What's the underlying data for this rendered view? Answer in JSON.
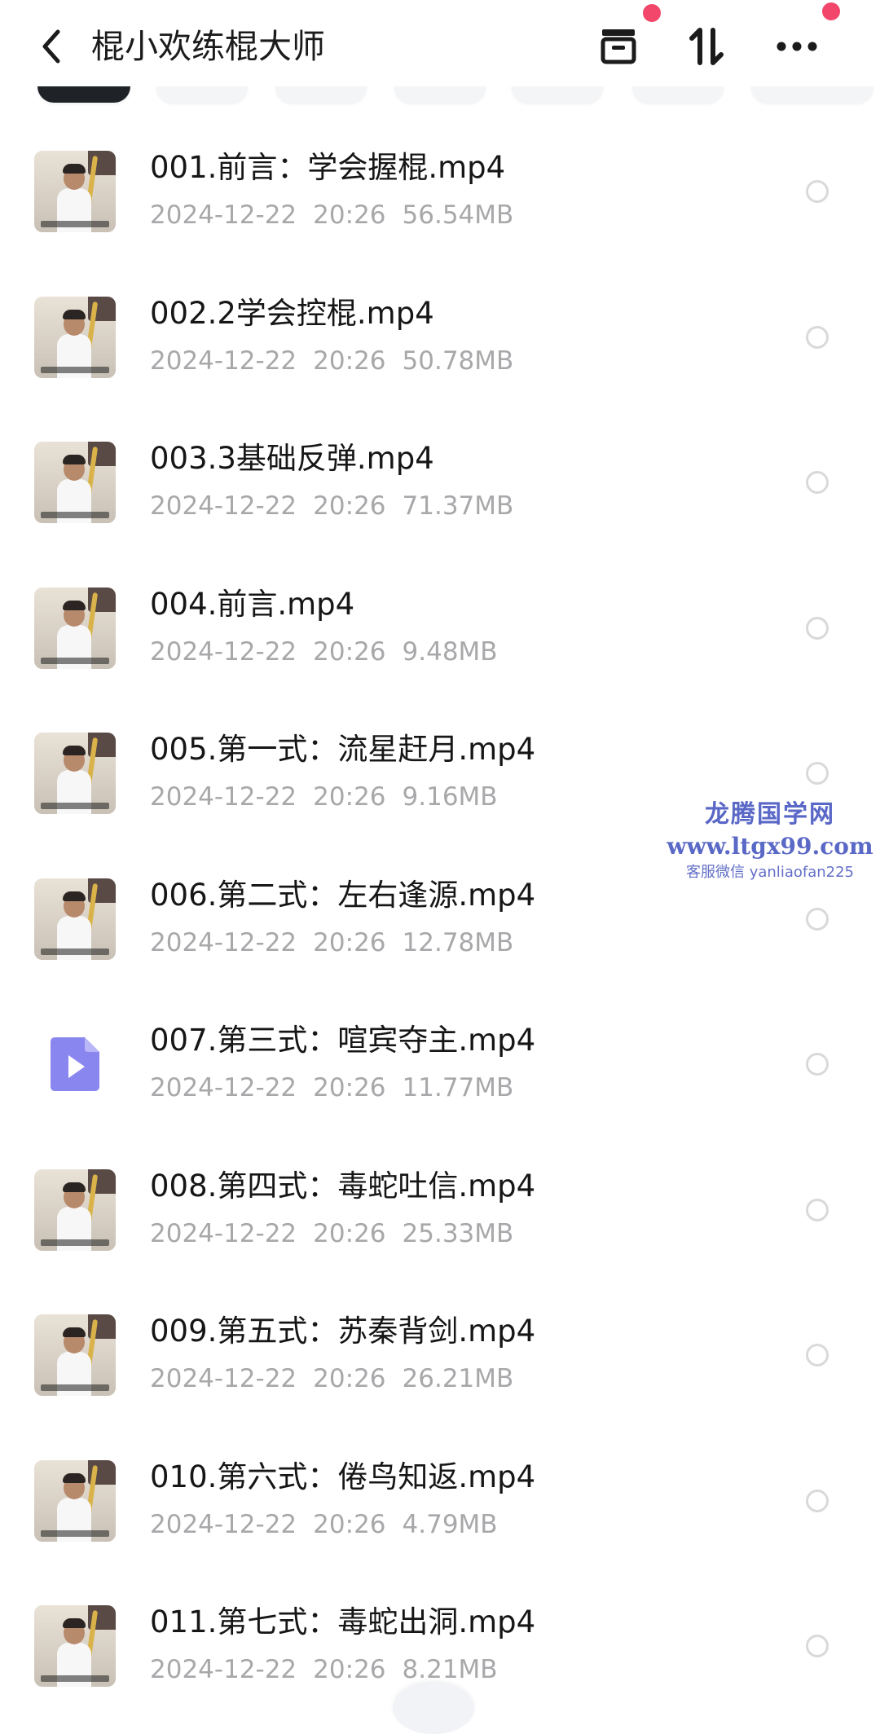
{
  "header": {
    "title": "棍小欢练棍大师",
    "icons": [
      "chevron-left-icon",
      "archive-box-icon",
      "sort-arrows-icon",
      "more-dots-icon"
    ],
    "badge_color": "#f2476a"
  },
  "files": [
    {
      "name": "001.前言：学会握棍.mp4",
      "date": "2024-12-22",
      "time": "20:26",
      "size": "56.54MB",
      "thumb": "video-thumbnail"
    },
    {
      "name": "002.2学会控棍.mp4",
      "date": "2024-12-22",
      "time": "20:26",
      "size": "50.78MB",
      "thumb": "video-thumbnail"
    },
    {
      "name": "003.3基础反弹.mp4",
      "date": "2024-12-22",
      "time": "20:26",
      "size": "71.37MB",
      "thumb": "video-thumbnail"
    },
    {
      "name": "004.前言.mp4",
      "date": "2024-12-22",
      "time": "20:26",
      "size": "9.48MB",
      "thumb": "video-thumbnail"
    },
    {
      "name": "005.第一式：流星赶月.mp4",
      "date": "2024-12-22",
      "time": "20:26",
      "size": "9.16MB",
      "thumb": "video-thumbnail"
    },
    {
      "name": "006.第二式：左右逢源.mp4",
      "date": "2024-12-22",
      "time": "20:26",
      "size": "12.78MB",
      "thumb": "video-thumbnail"
    },
    {
      "name": "007.第三式：喧宾夺主.mp4",
      "date": "2024-12-22",
      "time": "20:26",
      "size": "11.77MB",
      "thumb": "video-file-icon"
    },
    {
      "name": "008.第四式：毒蛇吐信.mp4",
      "date": "2024-12-22",
      "time": "20:26",
      "size": "25.33MB",
      "thumb": "video-thumbnail"
    },
    {
      "name": "009.第五式：苏秦背剑.mp4",
      "date": "2024-12-22",
      "time": "20:26",
      "size": "26.21MB",
      "thumb": "video-thumbnail"
    },
    {
      "name": "010.第六式：倦鸟知返.mp4",
      "date": "2024-12-22",
      "time": "20:26",
      "size": "4.79MB",
      "thumb": "video-thumbnail"
    },
    {
      "name": "011.第七式：毒蛇出洞.mp4",
      "date": "2024-12-22",
      "time": "20:26",
      "size": "8.21MB",
      "thumb": "video-thumbnail"
    }
  ],
  "watermark": {
    "line1": "龙腾国学网",
    "line2": "www.ltgx99.com",
    "line3": "客服微信 yanliaofan225"
  },
  "colors": {
    "file_icon": "#8a86f0",
    "meta_text": "#a8a8ab",
    "watermark": "#5967c7"
  }
}
